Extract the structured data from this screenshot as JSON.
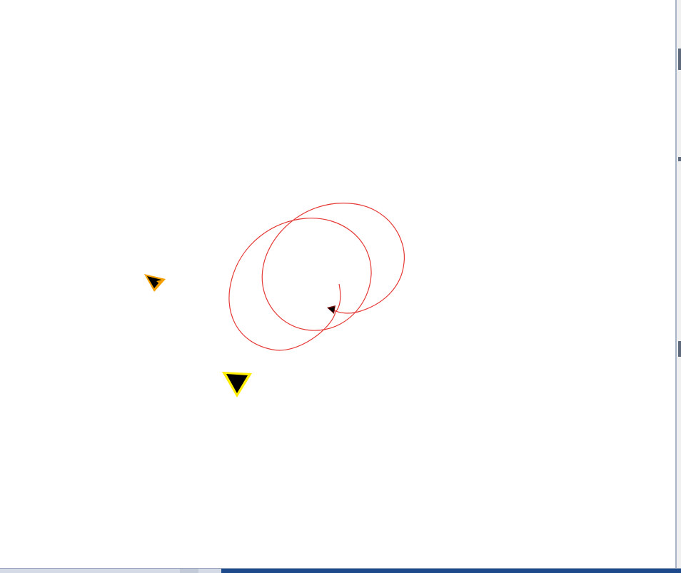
{
  "simulation": {
    "background": "#ffffff",
    "trail_color": "#e53935",
    "agents": [
      {
        "name": "orange-agent",
        "fill": "#000000",
        "outline": "#f5a000"
      },
      {
        "name": "yellow-agent",
        "fill": "#000000",
        "outline": "#ffee00"
      },
      {
        "name": "tracked-agent",
        "fill": "#000000",
        "outline": "#7a1010"
      }
    ]
  },
  "colors": {
    "window_border": "#a7b3c6",
    "taskbar": "#1c4a8a"
  }
}
